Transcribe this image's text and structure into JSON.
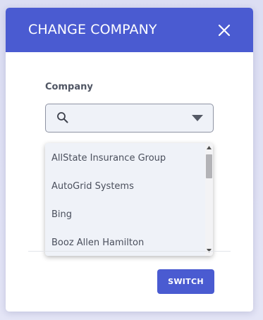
{
  "modal": {
    "title": "CHANGE COMPANY",
    "close_icon": "close-icon"
  },
  "company_field": {
    "label": "Company",
    "search_value": "",
    "search_icon": "search-icon",
    "caret_icon": "caret-down-icon",
    "options": [
      "AllState Insurance Group",
      "AutoGrid Systems",
      "Bing",
      "Booz Allen Hamilton"
    ]
  },
  "footer": {
    "switch_label": "SWITCH"
  },
  "colors": {
    "accent": "#4a5bd1",
    "field_background": "#eff2f8",
    "label_text": "#4f5563",
    "option_text": "#4a4f5c"
  }
}
